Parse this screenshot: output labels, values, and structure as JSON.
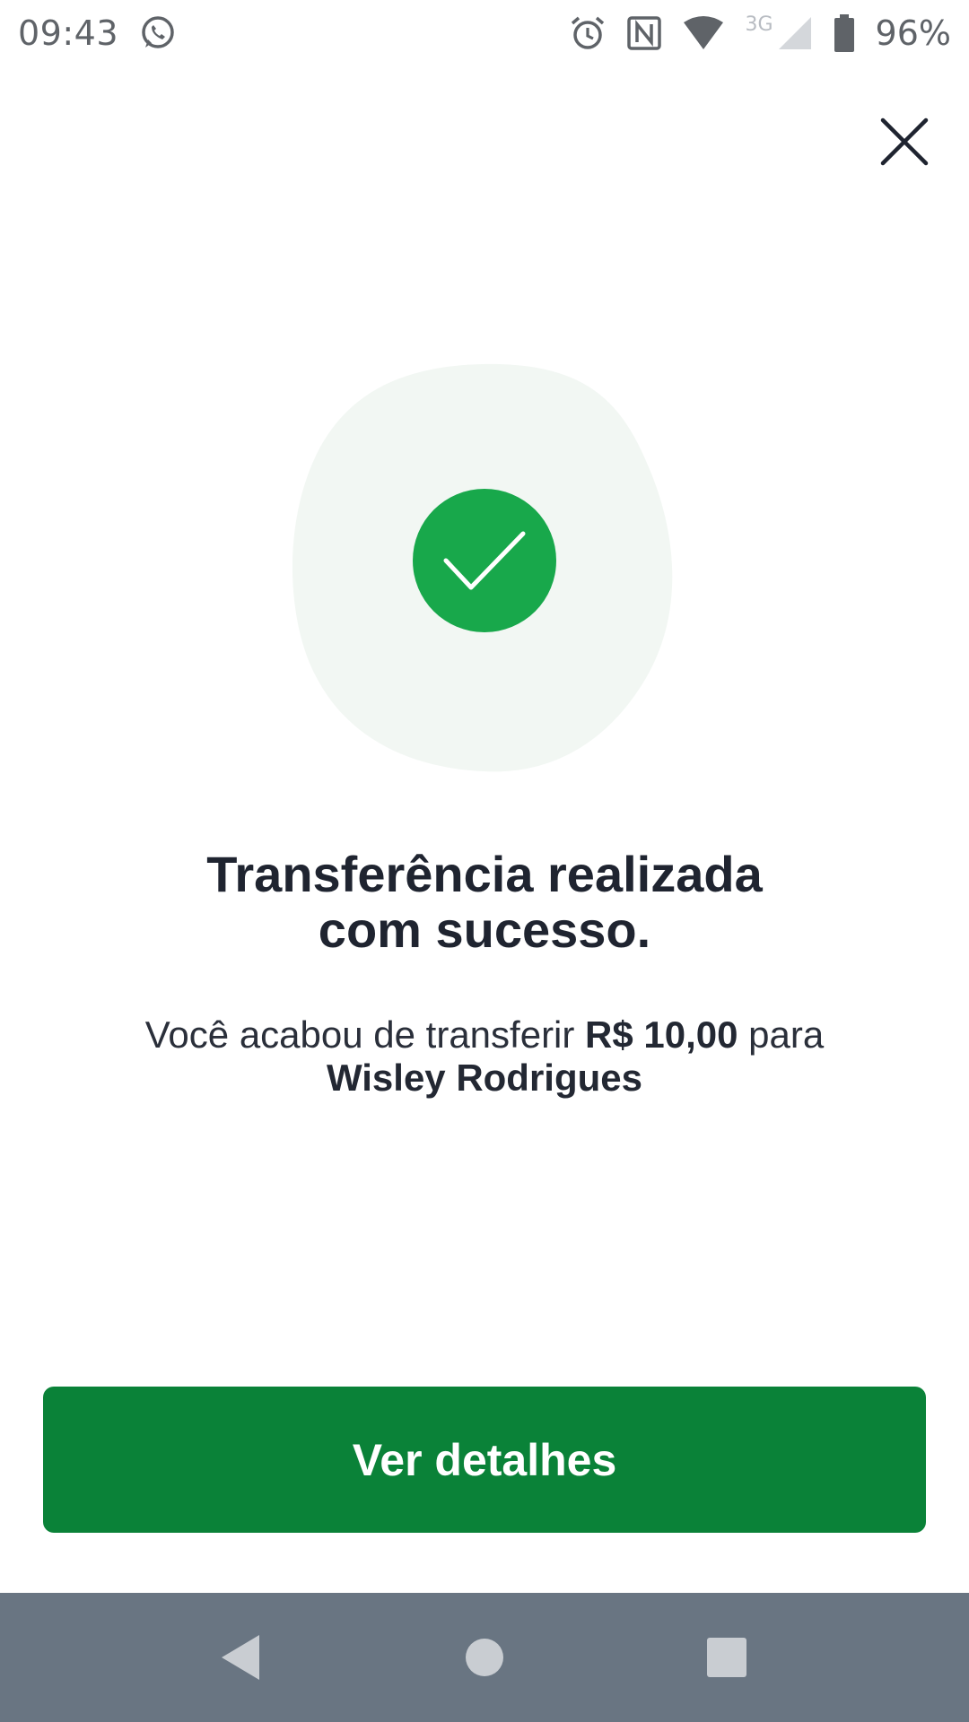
{
  "status_bar": {
    "time": "09:43",
    "network_type": "3G",
    "battery": "96%",
    "icons": [
      "whatsapp-icon",
      "alarm-icon",
      "nfc-icon",
      "wifi-icon",
      "cellular-signal-icon",
      "battery-icon"
    ]
  },
  "header": {
    "close_icon": "close-icon"
  },
  "success": {
    "icon": "check-icon",
    "title_line1": "Transferência realizada",
    "title_line2": "com sucesso.",
    "message_prefix": "Você acabou de transferir ",
    "amount": "R$ 10,00",
    "message_middle": " para",
    "recipient": "Wisley Rodrigues"
  },
  "actions": {
    "details_button_label": "Ver detalhes"
  },
  "navigation": {
    "icons": [
      "back-icon",
      "home-icon",
      "recents-icon"
    ]
  },
  "colors": {
    "primary": "#0a8238",
    "success_circle": "#18a84b",
    "blob_background": "#f2f7f3",
    "text_dark": "#1f2430",
    "nav_bar": "#697582"
  }
}
